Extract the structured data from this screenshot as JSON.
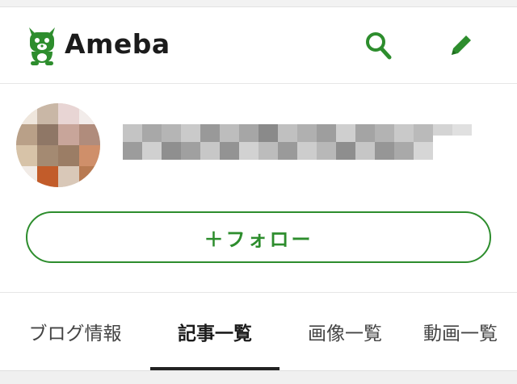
{
  "header": {
    "logo_text": "Ameba",
    "logo_icon": "ameba-mascot-icon",
    "search_icon": "search-icon",
    "edit_icon": "pencil-icon",
    "brand_color": "#2d8d2d"
  },
  "profile": {
    "avatar_note": "avatar (pixelated)",
    "blog_name": "",
    "follow_label": "＋フォロー"
  },
  "tabs": [
    {
      "label": "ブログ情報",
      "active": false
    },
    {
      "label": "記事一覧",
      "active": true
    },
    {
      "label": "画像一覧",
      "active": false
    },
    {
      "label": "動画一覧",
      "active": false
    }
  ]
}
